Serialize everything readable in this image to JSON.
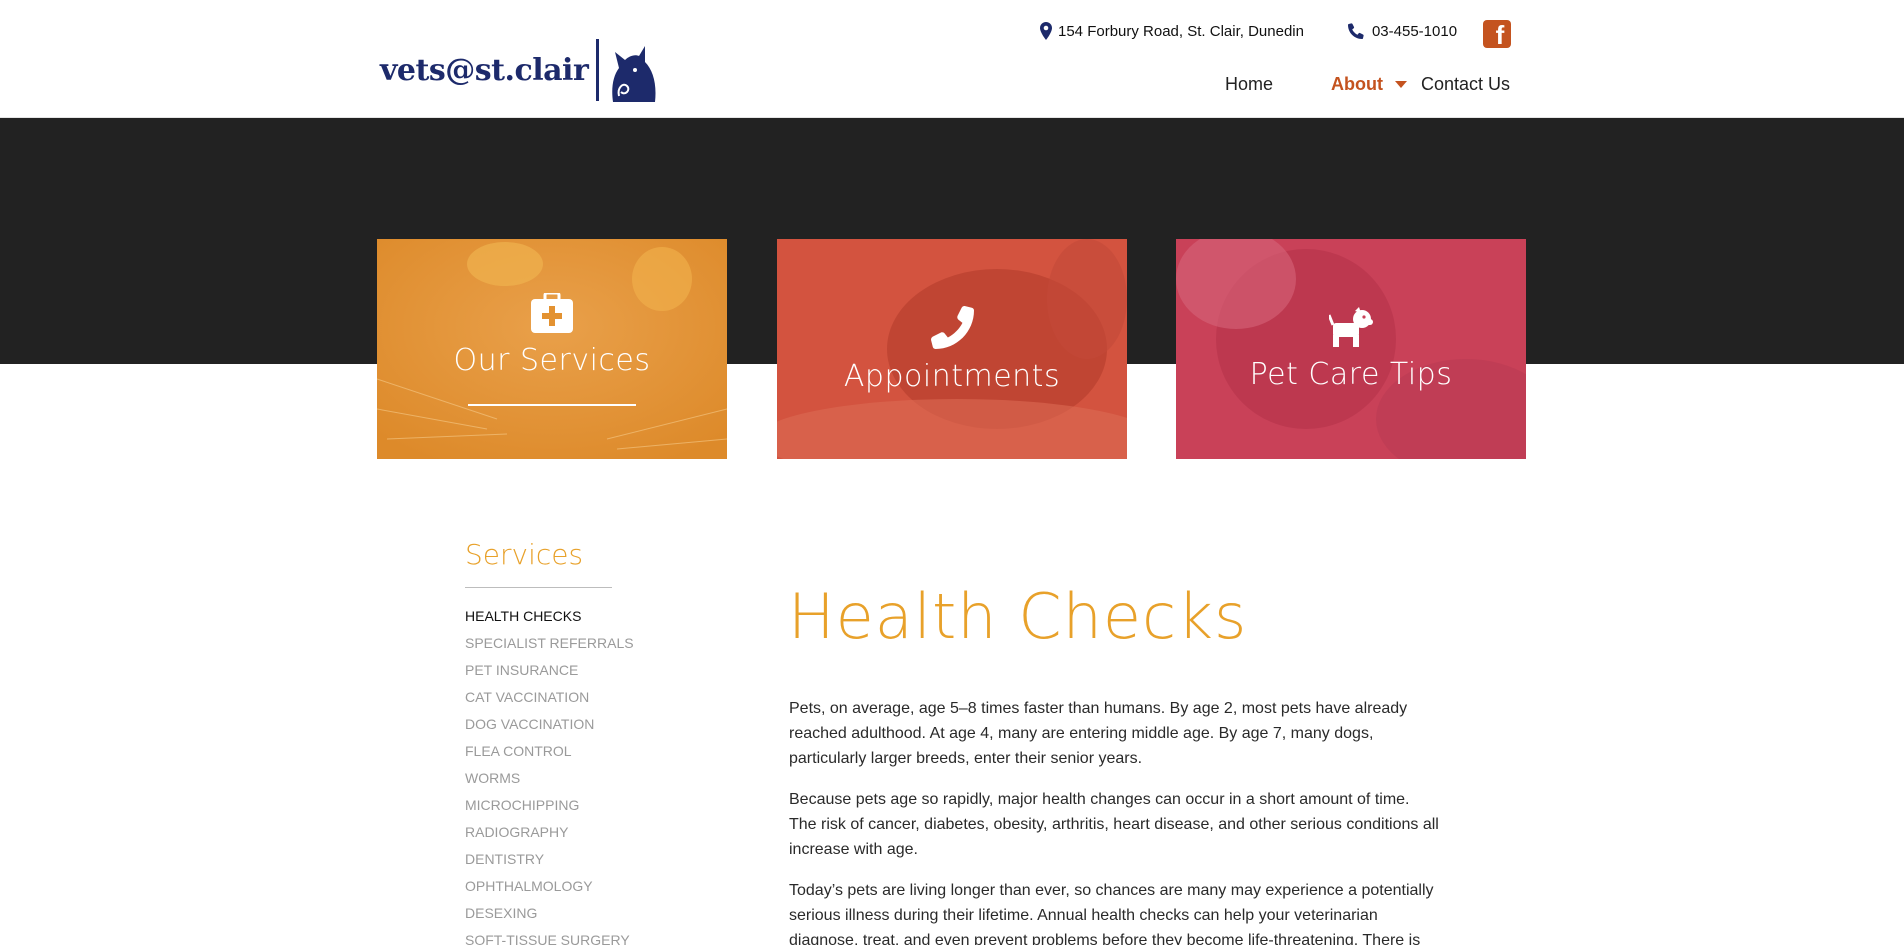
{
  "header": {
    "logo_text": "vets@st.clair",
    "address": "154 Forbury Road, St. Clair, Dunedin",
    "phone": "03-455-1010",
    "facebook_glyph": "f",
    "nav": {
      "home": "Home",
      "about": "About",
      "contact": "Contact Us"
    }
  },
  "tiles": [
    {
      "label": "Our Services",
      "icon": "medkit-icon",
      "color": "#e5922e"
    },
    {
      "label": "Appointments",
      "icon": "phone-icon",
      "color": "#d3533f"
    },
    {
      "label": "Pet Care Tips",
      "icon": "dog-icon",
      "color": "#c94158"
    }
  ],
  "sidebar": {
    "title": "Services",
    "items": [
      "HEALTH CHECKS",
      "SPECIALIST REFERRALS",
      "PET INSURANCE",
      "CAT VACCINATION",
      "DOG VACCINATION",
      "FLEA CONTROL",
      "WORMS",
      "MICROCHIPPING",
      "RADIOGRAPHY",
      "DENTISTRY",
      "OPHTHALMOLOGY",
      "DESEXING",
      "SOFT-TISSUE SURGERY"
    ]
  },
  "main": {
    "title": "Health Checks",
    "paragraphs": [
      "Pets, on average, age 5–8 times faster than humans. By age 2, most pets have already reached adulthood. At age 4, many are entering middle age. By age 7, many dogs, particularly larger breeds, enter their senior years.",
      "Because pets age so rapidly, major health changes can occur in a short amount of time. The risk of cancer, diabetes, obesity, arthritis, heart disease, and other serious conditions all increase with age.",
      "Today’s pets are living longer than ever, so chances are many may experience a potentially serious illness during their lifetime. Annual health checks can help your veterinarian diagnose, treat, and even prevent problems before they become life-threatening. There is"
    ]
  },
  "colors": {
    "brand_navy": "#1d2a6b",
    "accent_orange": "#c4531f",
    "heading_gold": "#e8a12a",
    "band_dark": "#222222"
  }
}
